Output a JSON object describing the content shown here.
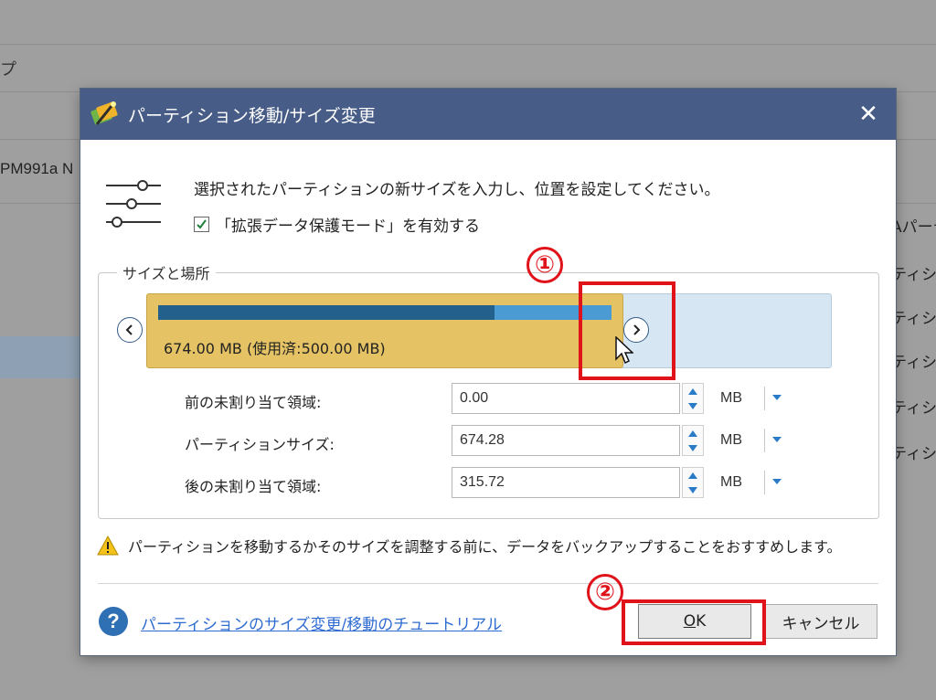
{
  "background": {
    "menu_fragment": "プ",
    "left_label_fragment": "PM991a N",
    "right_items": [
      "Aパーテ",
      "ティショ",
      "ティショ",
      "ティショ",
      "ティショ",
      "ティショ"
    ]
  },
  "dialog": {
    "title": "パーティション移動/サイズ変更",
    "close_symbol": "✕",
    "description": "選択されたパーティションの新サイズを入力し、位置を設定してください。",
    "checkbox_label": "「拡張データ保護モード」を有効する",
    "checkbox_checked": true,
    "group_title": "サイズと場所",
    "partition_block": {
      "label": "674.00 MB (使用済:500.00 MB)",
      "used_fraction": 0.742
    },
    "fields": [
      {
        "label": "前の未割り当て領域:",
        "value": "0.00",
        "unit": "MB"
      },
      {
        "label": "パーティションサイズ:",
        "value": "674.28",
        "unit": "MB"
      },
      {
        "label": "後の未割り当て領域:",
        "value": "315.72",
        "unit": "MB"
      }
    ],
    "warning": "パーティションを移動するかそのサイズを調整する前に、データをバックアップすることをおすすめします。",
    "help_link": "パーティションのサイズ変更/移動のチュートリアル",
    "ok_label": "OK",
    "ok_underline": "O",
    "ok_rest": "K",
    "cancel_label": "キャンセル"
  },
  "annotations": {
    "step1": "①",
    "step2": "②"
  },
  "colors": {
    "titlebar": "#475c86",
    "partition": "#e5c365",
    "used": "#24608c",
    "free": "#4a9ad4",
    "annotation": "#e0121a"
  }
}
